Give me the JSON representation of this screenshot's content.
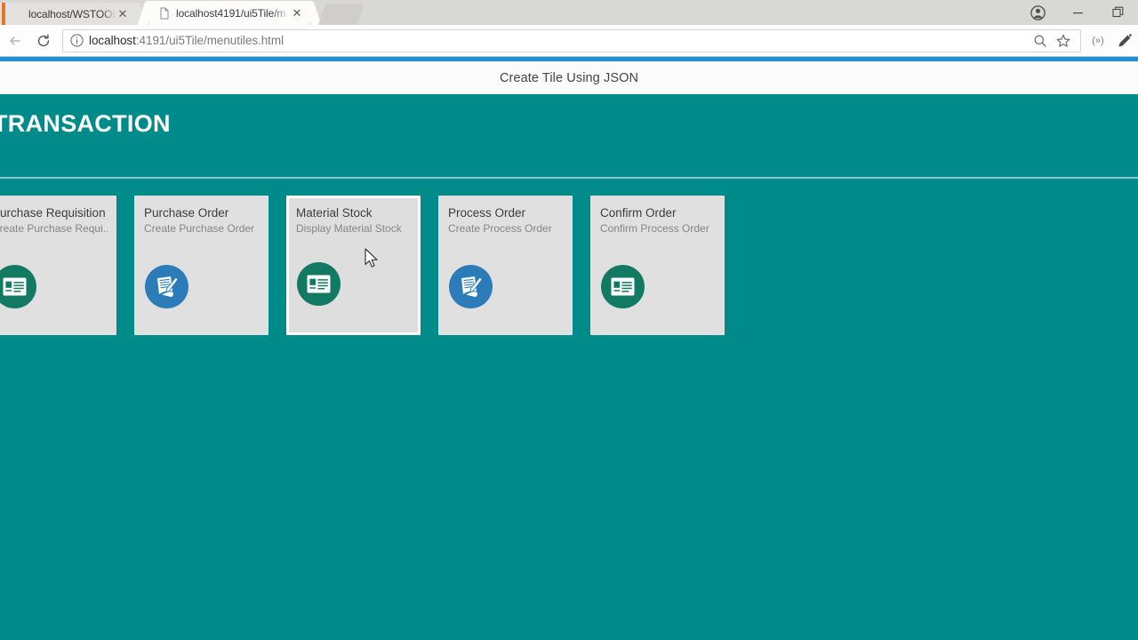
{
  "browser": {
    "tabs": [
      {
        "title": "localhost/WSTOOL/Serv",
        "active": false,
        "favicon": "orange-accent-favicon",
        "close_label": "✕"
      },
      {
        "title": "localhost4191/ui5Tile/m",
        "active": true,
        "favicon": "page-document-favicon",
        "close_label": "✕"
      }
    ],
    "window_controls": {
      "profile": "profile-avatar-icon",
      "minimize": "—",
      "maximize": "maximize-icon"
    },
    "toolbar": {
      "back_icon": "back-arrow-icon",
      "forward_icon": "forward-arrow-icon",
      "reload_icon": "reload-icon",
      "info_icon": "page-info-icon",
      "url_prefix": "localhost",
      "url_suffix": ":4191/ui5Tile/menutiles.html",
      "url_full": "localhost:4191/ui5Tile/menutiles.html",
      "search_icon": "magnifier-icon",
      "bookmark_icon": "star-icon",
      "extension_one": "(»)",
      "extension_two": "comet-extension-icon"
    }
  },
  "page": {
    "header_title": "Create Tile Using JSON",
    "group_title": "TRANSACTION",
    "accent_color": "#008b8b",
    "tile_bg_color": "#e0e0e0",
    "icon_green": "#127a62",
    "icon_blue": "#2b7cb9",
    "tiles": [
      {
        "title": "Purchase Requisition",
        "subtitle": "Create Purchase Requi...",
        "icon": "id-card-icon",
        "icon_style": "green",
        "hovered": false
      },
      {
        "title": "Purchase Order",
        "subtitle": "Create Purchase Order",
        "icon": "document-pen-icon",
        "icon_style": "blue",
        "hovered": false
      },
      {
        "title": "Material Stock",
        "subtitle": "Display Material Stock",
        "icon": "id-card-icon",
        "icon_style": "green",
        "hovered": true
      },
      {
        "title": "Process Order",
        "subtitle": "Create Process Order",
        "icon": "document-pen-icon",
        "icon_style": "blue",
        "hovered": false
      },
      {
        "title": "Confirm Order",
        "subtitle": "Confirm Process Order",
        "icon": "id-card-icon",
        "icon_style": "green",
        "hovered": false
      }
    ]
  }
}
